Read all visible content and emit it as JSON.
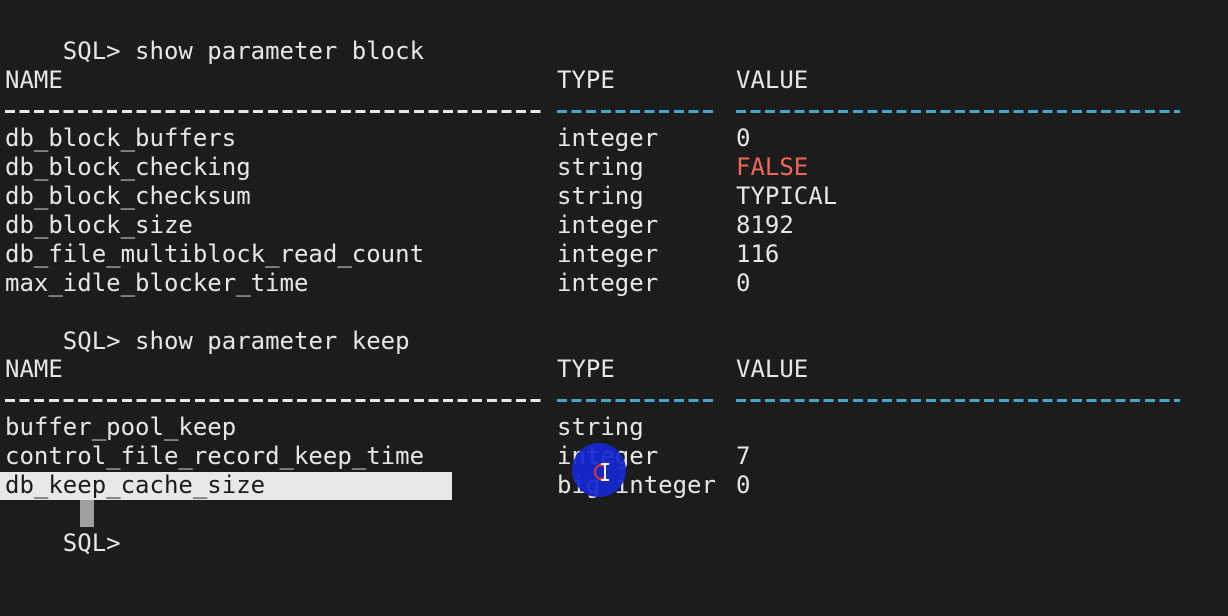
{
  "block1": {
    "prompt": "SQL>",
    "command": "show parameter block",
    "headers": {
      "name": "NAME",
      "type": "TYPE",
      "value": "VALUE"
    },
    "rows": [
      {
        "name": "db_block_buffers",
        "type": "integer",
        "value": "0"
      },
      {
        "name": "db_block_checking",
        "type": "string",
        "value": "FALSE"
      },
      {
        "name": "db_block_checksum",
        "type": "string",
        "value": "TYPICAL"
      },
      {
        "name": "db_block_size",
        "type": "integer",
        "value": "8192"
      },
      {
        "name": "db_file_multiblock_read_count",
        "type": "integer",
        "value": "116"
      },
      {
        "name": "max_idle_blocker_time",
        "type": "integer",
        "value": "0"
      }
    ]
  },
  "block2": {
    "prompt": "SQL>",
    "command": "show parameter keep",
    "headers": {
      "name": "NAME",
      "type": "TYPE",
      "value": "VALUE"
    },
    "rows": [
      {
        "name": "buffer_pool_keep",
        "type": "string",
        "value": ""
      },
      {
        "name": "control_file_record_keep_time",
        "type": "integer",
        "value": "7"
      },
      {
        "name": "db_keep_cache_size",
        "type": "big integer",
        "value": "0"
      }
    ]
  },
  "final_prompt": "SQL>",
  "colors": {
    "background": "#1c1c1c",
    "text": "#e6e6e6",
    "separator_blue": "#4aa3c8",
    "highlight_value": "#f0675a",
    "selection": "#e8e8e8",
    "click_indicator": "#1428d2"
  },
  "icons": {
    "click_indicator": "mouse-click-indicator-icon",
    "text_cursor": "ibeam-cursor-icon"
  }
}
